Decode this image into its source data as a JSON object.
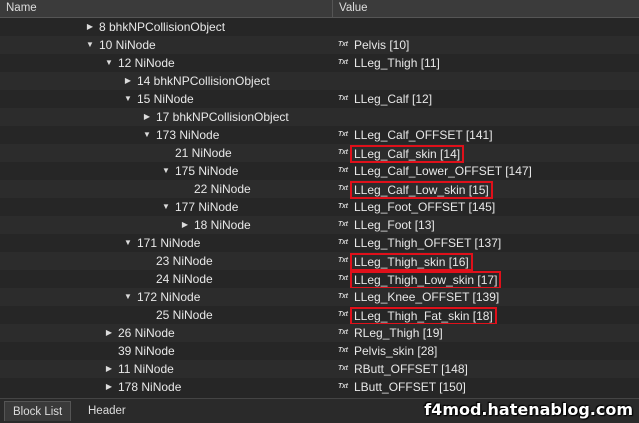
{
  "header": {
    "name": "Name",
    "value": "Value"
  },
  "rows": [
    {
      "indent": 5,
      "arrow": "collapsed",
      "name": "8 bhkNPCollisionObject",
      "value": "",
      "hl": false
    },
    {
      "indent": 5,
      "arrow": "expanded",
      "name": "10 NiNode",
      "value": "Pelvis [10]",
      "hl": false
    },
    {
      "indent": 6,
      "arrow": "expanded",
      "name": "12 NiNode",
      "value": "LLeg_Thigh [11]",
      "hl": false
    },
    {
      "indent": 7,
      "arrow": "collapsed",
      "name": "14 bhkNPCollisionObject",
      "value": "",
      "hl": false
    },
    {
      "indent": 7,
      "arrow": "expanded",
      "name": "15 NiNode",
      "value": "LLeg_Calf [12]",
      "hl": false
    },
    {
      "indent": 8,
      "arrow": "collapsed",
      "name": "17 bhkNPCollisionObject",
      "value": "",
      "hl": false
    },
    {
      "indent": 8,
      "arrow": "expanded",
      "name": "173 NiNode",
      "value": "LLeg_Calf_OFFSET [141]",
      "hl": false
    },
    {
      "indent": 9,
      "arrow": "none",
      "name": "21 NiNode",
      "value": "LLeg_Calf_skin [14]",
      "hl": true
    },
    {
      "indent": 9,
      "arrow": "expanded",
      "name": "175 NiNode",
      "value": "LLeg_Calf_Lower_OFFSET [147]",
      "hl": false
    },
    {
      "indent": 10,
      "arrow": "none",
      "name": "22 NiNode",
      "value": "LLeg_Calf_Low_skin [15]",
      "hl": true
    },
    {
      "indent": 9,
      "arrow": "expanded",
      "name": "177 NiNode",
      "value": "LLeg_Foot_OFFSET [145]",
      "hl": false
    },
    {
      "indent": 10,
      "arrow": "collapsed",
      "name": "18 NiNode",
      "value": "LLeg_Foot [13]",
      "hl": false
    },
    {
      "indent": 7,
      "arrow": "expanded",
      "name": "171 NiNode",
      "value": "LLeg_Thigh_OFFSET [137]",
      "hl": false
    },
    {
      "indent": 8,
      "arrow": "none",
      "name": "23 NiNode",
      "value": "LLeg_Thigh_skin [16]",
      "hl": true
    },
    {
      "indent": 8,
      "arrow": "none",
      "name": "24 NiNode",
      "value": "LLeg_Thigh_Low_skin [17]",
      "hl": true
    },
    {
      "indent": 7,
      "arrow": "expanded",
      "name": "172 NiNode",
      "value": "LLeg_Knee_OFFSET [139]",
      "hl": false
    },
    {
      "indent": 8,
      "arrow": "none",
      "name": "25 NiNode",
      "value": "LLeg_Thigh_Fat_skin [18]",
      "hl": true
    },
    {
      "indent": 6,
      "arrow": "collapsed",
      "name": "26 NiNode",
      "value": "RLeg_Thigh [19]",
      "hl": false
    },
    {
      "indent": 6,
      "arrow": "none",
      "name": "39 NiNode",
      "value": "Pelvis_skin [28]",
      "hl": false
    },
    {
      "indent": 6,
      "arrow": "collapsed",
      "name": "11 NiNode",
      "value": "RButt_OFFSET [148]",
      "hl": false
    },
    {
      "indent": 6,
      "arrow": "collapsed",
      "name": "178 NiNode",
      "value": "LButt_OFFSET [150]",
      "hl": false
    }
  ],
  "txt_icon_label": "Txt",
  "tabs": [
    {
      "label": "Block List",
      "active": true
    },
    {
      "label": "Header",
      "active": false
    }
  ],
  "watermark": "f4mod.hatenablog.com",
  "colors": {
    "highlight": "#e0101a",
    "background": "#262626",
    "header": "#3b3b3b"
  }
}
